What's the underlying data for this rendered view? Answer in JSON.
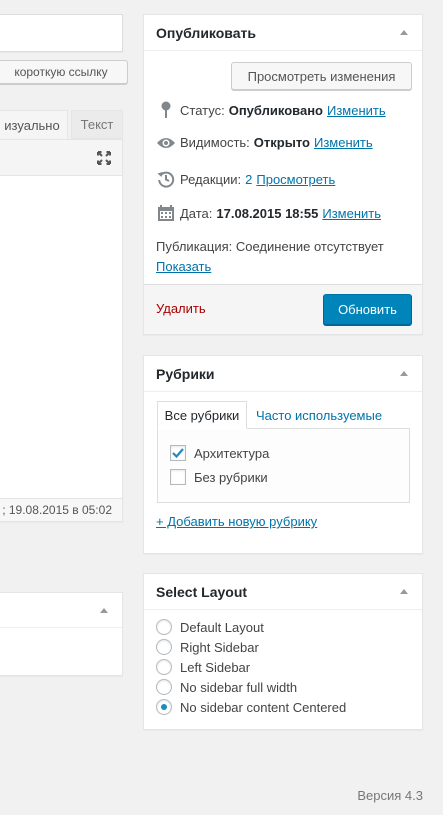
{
  "left": {
    "shortlink_button": "короткую ссылку",
    "tab_visual": "изуально",
    "tab_text": "Текст",
    "editor_footer": "; 19.08.2015 в 05:02"
  },
  "publish": {
    "title": "Опубликовать",
    "preview_button": "Просмотреть изменения",
    "status_label": "Статус:",
    "status_value": "Опубликовано",
    "status_edit": "Изменить",
    "visibility_label": "Видимость:",
    "visibility_value": "Открыто",
    "visibility_edit": "Изменить",
    "revisions_label": "Редакции:",
    "revisions_count": "2",
    "revisions_view": "Просмотреть",
    "date_label": "Дата:",
    "date_value": "17.08.2015 18:55",
    "date_edit": "Изменить",
    "publication_text": "Публикация: Соединение отсутствует",
    "show_link": "Показать",
    "delete_link": "Удалить",
    "update_button": "Обновить"
  },
  "categories": {
    "title": "Рубрики",
    "tab_all": "Все рубрики",
    "tab_popular": "Часто используемые",
    "items": [
      {
        "label": "Архитектура",
        "checked": true
      },
      {
        "label": "Без рубрики",
        "checked": false
      }
    ],
    "add_link": "+ Добавить новую рубрику"
  },
  "layout": {
    "title": "Select Layout",
    "options": [
      {
        "label": "Default Layout",
        "selected": false
      },
      {
        "label": "Right Sidebar",
        "selected": false
      },
      {
        "label": "Left Sidebar",
        "selected": false
      },
      {
        "label": "No sidebar full width",
        "selected": false
      },
      {
        "label": "No sidebar content Centered",
        "selected": true
      }
    ]
  },
  "footer": {
    "version": "Версия 4.3"
  },
  "colors": {
    "link": "#0073aa",
    "delete": "#a00",
    "primary": "#0085ba",
    "radio_selected": "#1e8cbe"
  }
}
